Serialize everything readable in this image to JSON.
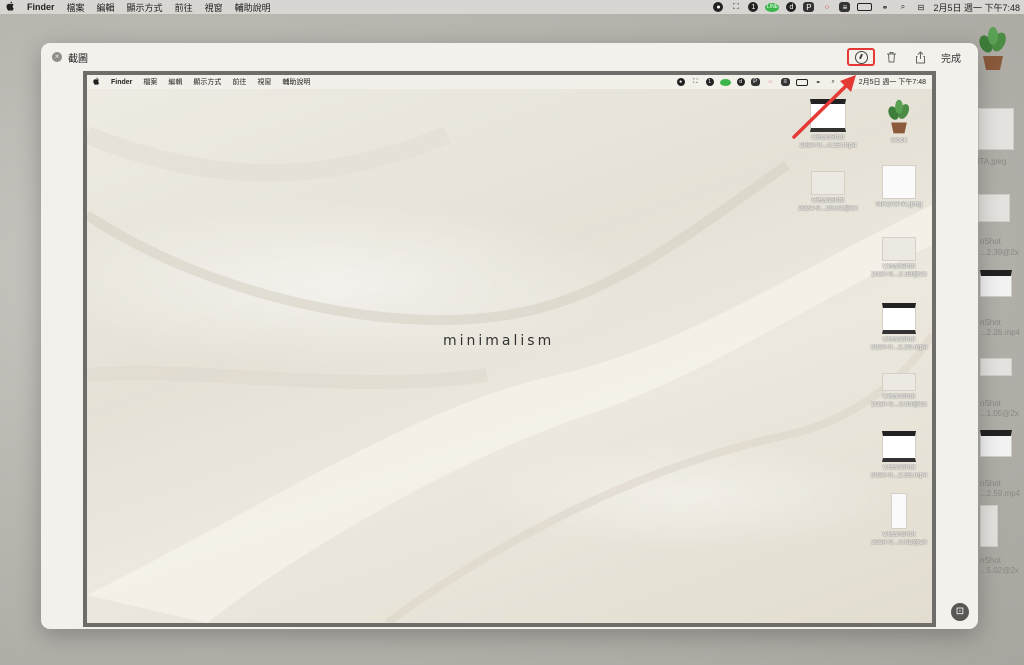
{
  "menubar": {
    "app_name": "Finder",
    "menus": [
      "檔案",
      "編輯",
      "顯示方式",
      "前往",
      "視窗",
      "輔助說明"
    ],
    "status_icons": [
      "record-icon",
      "grab-icon",
      "one-icon",
      "line-icon",
      "d-icon",
      "p-icon",
      "dots-icon",
      "list-icon",
      "battery-icon",
      "link-icon",
      "search-icon",
      "control-center-icon"
    ],
    "line_badge": "LINE",
    "one_badge": "1",
    "d_badge": "d",
    "p_badge": "P",
    "clock": "2月5日 週一  下午7:48"
  },
  "window": {
    "title": "截圖",
    "done_label": "完成"
  },
  "inner": {
    "app_name": "Finder",
    "menus": [
      "檔案",
      "編輯",
      "顯示方式",
      "前往",
      "視窗",
      "輔助說明"
    ],
    "clock": "2月5日 週一  下午7:48",
    "wallpaper_text": "minimalism",
    "desktop_icons": [
      {
        "label1": "CleanShot",
        "label2": "2024-0...4.23.mp4",
        "kind": "video"
      },
      {
        "label1": "Dock",
        "label2": "",
        "kind": "plant"
      },
      {
        "label1": "CleanShot",
        "label2": "2024-0...26.01@2x",
        "kind": "light"
      },
      {
        "label1": "MK2A3TA.jpeg",
        "label2": "",
        "kind": "keyboard"
      },
      {
        "label1": "CleanShot",
        "label2": "2024-0...2.39@2x",
        "kind": "light"
      },
      {
        "label1": "CleanShot",
        "label2": "2024-0...2.26.mp4",
        "kind": "video"
      },
      {
        "label1": "CleanShot",
        "label2": "2024-0...3.05@2x",
        "kind": "light"
      },
      {
        "label1": "CleanShot",
        "label2": "2024-0...2.59.mp4",
        "kind": "video"
      },
      {
        "label1": "CleanShot",
        "label2": "2024-0...5.02@2x",
        "kind": "doc"
      }
    ]
  },
  "background_labels": {
    "jpeg": "3TA.jpeg",
    "a": "nShot",
    "a2": "...2.39@2x",
    "b": "nShot",
    "b2": "...2.26.mp4",
    "c": "nShot",
    "c2": "...1.05@2x",
    "d": "nShot",
    "d2": "...2.59.mp4",
    "e": "nShot",
    "e2": "...5.02@2x"
  },
  "colors": {
    "highlight": "#e53935",
    "arrow": "#e53935"
  }
}
